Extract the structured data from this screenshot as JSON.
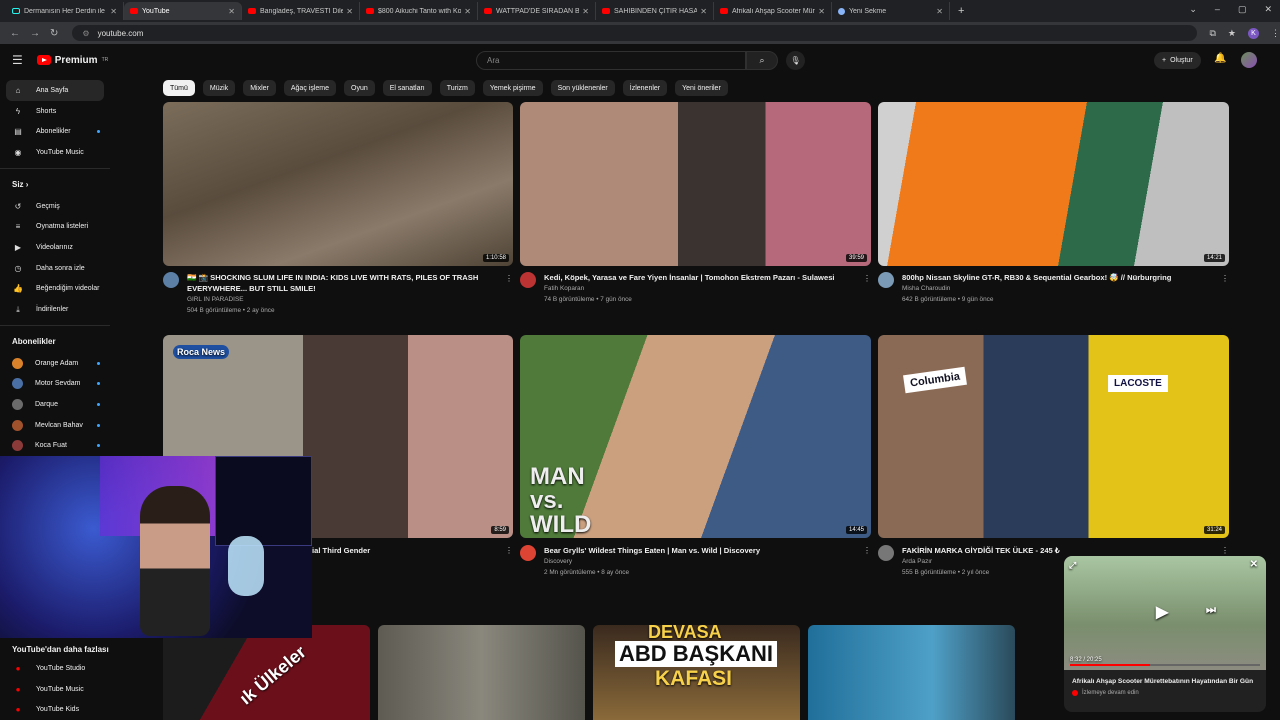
{
  "browser": {
    "tabs": [
      {
        "label": "Dermanısın Her Derdin ile Gelv",
        "icon": "tiktok-icon"
      },
      {
        "label": "YouTube",
        "icon": "youtube-icon"
      },
      {
        "label": "Bangladeş, TRAVESTİ Dilenciler",
        "icon": "youtube-icon"
      },
      {
        "label": "$800 Aikuchi Tanto with Kozuk",
        "icon": "youtube-icon"
      },
      {
        "label": "WATTPAD'DE SIRADAN BİR GÜN",
        "icon": "youtube-icon"
      },
      {
        "label": "SAHİBİNDEN ÇITIR HASARLI A",
        "icon": "youtube-icon"
      },
      {
        "label": "Afrikalı Ahşap Scooter Mürettı",
        "icon": "youtube-icon"
      },
      {
        "label": "Yeni Sekme",
        "icon": "globe-icon"
      }
    ],
    "url": "youtube.com",
    "profile_initial": "K"
  },
  "header": {
    "logo_text": "Premium",
    "logo_sup": "TR",
    "search_placeholder": "Ara",
    "create_label": "Oluştur"
  },
  "chips": [
    "Tümü",
    "Müzik",
    "Mixler",
    "Ağaç işleme",
    "Oyun",
    "El sanatları",
    "Turizm",
    "Yemek pişirme",
    "Son yüklenenler",
    "İzlenenler",
    "Yeni öneriler"
  ],
  "sidebar": {
    "main": [
      {
        "label": "Ana Sayfa",
        "icon": "home-icon"
      },
      {
        "label": "Shorts",
        "icon": "shorts-icon"
      },
      {
        "label": "Abonelikler",
        "icon": "subscriptions-icon"
      },
      {
        "label": "YouTube Music",
        "icon": "music-icon"
      }
    ],
    "you_heading": "Siz",
    "you": [
      {
        "label": "Geçmiş",
        "icon": "history-icon"
      },
      {
        "label": "Oynatma listeleri",
        "icon": "playlist-icon"
      },
      {
        "label": "Videolarınız",
        "icon": "your-videos-icon"
      },
      {
        "label": "Daha sonra izle",
        "icon": "watch-later-icon"
      },
      {
        "label": "Beğendiğim videolar",
        "icon": "like-icon"
      },
      {
        "label": "İndirilenler",
        "icon": "download-icon"
      }
    ],
    "subs_heading": "Abonelikler",
    "subs": [
      {
        "label": "Orange Adam",
        "color": "#d9822b"
      },
      {
        "label": "Motor Sevdam",
        "color": "#4a6fa5"
      },
      {
        "label": "Darque",
        "color": "#6b6b6b"
      },
      {
        "label": "Mevlcan Bahav",
        "color": "#a0522d"
      },
      {
        "label": "Koca Fuat",
        "color": "#8b3a3a"
      }
    ],
    "more_heading": "YouTube'dan daha fazlası",
    "more": [
      {
        "label": "YouTube Studio"
      },
      {
        "label": "YouTube Music"
      },
      {
        "label": "YouTube Kids"
      }
    ]
  },
  "videos": [
    {
      "title1": "🇮🇳 📸 SHOCKING SLUM LIFE IN INDIA: KIDS LIVE WITH RATS, PILES OF TRASH",
      "title2": "EVERYWHERE... BUT STILL SMILE!",
      "channel": "GIRL IN PARADISE",
      "meta": "504 B görüntüleme • 2 ay önce",
      "duration": "1:10:58"
    },
    {
      "title1": "Kedi, Köpek, Yarasa ve Fare Yiyen İnsanlar | Tomohon Ekstrem Pazarı - Sulawesi",
      "title2": "",
      "channel": "Fatih Koparan",
      "meta": "74 B görüntüleme • 7 gün önce",
      "duration": "39:59"
    },
    {
      "title1": "800hp Nissan Skyline GT-R, RB30 & Sequential Gearbox! 🤯 // Nürburgring",
      "title2": "",
      "channel": "Misha Charoudin",
      "meta": "642 B görüntüleme • 9 gün önce",
      "duration": "14:21"
    },
    {
      "title1": "ial Third Gender",
      "title2": "",
      "channel": "",
      "meta": "",
      "duration": "8:59"
    },
    {
      "title1": "Bear Grylls' Wildest Things Eaten | Man vs. Wild | Discovery",
      "title2": "",
      "channel": "Discovery",
      "meta": "2 Mn görüntüleme • 8 ay önce",
      "duration": "14:45"
    },
    {
      "title1": "FAKİRİN MARKA GİYDİĞİ TEK ÜLKE - 245 ₺",
      "title2": "",
      "channel": "Arda Pazır",
      "meta": "555 B görüntüleme • 2 yıl önce",
      "duration": "31:24"
    }
  ],
  "thumb_text": {
    "roca": "Roca News",
    "man_vs_wild": "MAN vs. WILD",
    "columbia": "Columbia",
    "lacoste": "LACOSTE",
    "devasa1": "DEVASA",
    "devasa2": "ABD BAŞKANI",
    "devasa3": "KAFASI",
    "ulkeler": "ık Ülkeler"
  },
  "miniplayer": {
    "title": "Afrikalı Ahşap Scooter Mürettebatının Hayatından Bir Gün",
    "subtitle": "İzlemeye devam edin",
    "time": "8:32 / 20:25"
  },
  "colors": {
    "accent": "#ff0000",
    "badge": "#3ea6ff"
  }
}
